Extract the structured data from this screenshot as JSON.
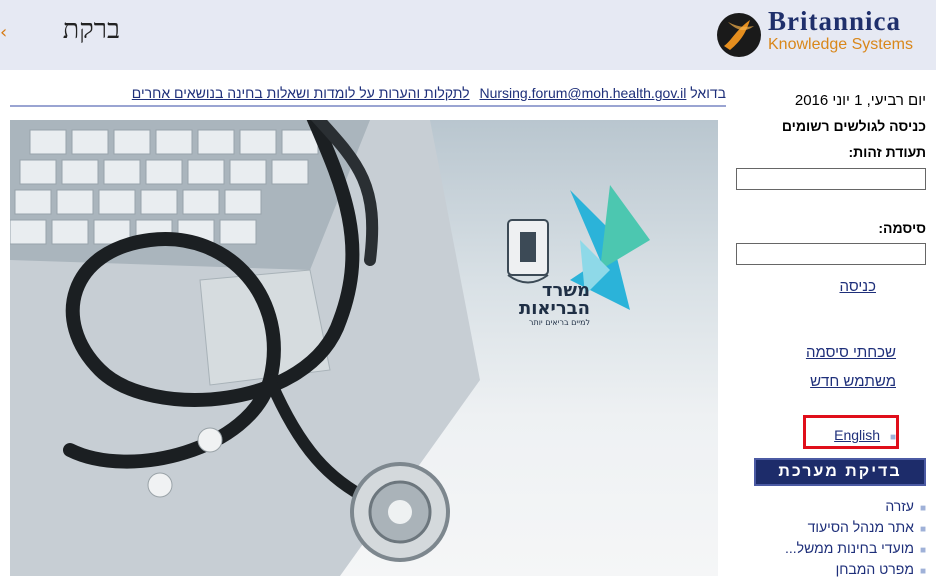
{
  "header": {
    "title": "ברקת",
    "logo": {
      "brand": "Britannica",
      "subtitle": "Knowledge Systems"
    }
  },
  "marquee": {
    "prefix": "בדואל",
    "email": "Nursing.forum@moh.health.gov.il",
    "text": "לתקלות והערות על לומדות ושאלות בחינה בנושאים אחרים"
  },
  "hero": {
    "ministry_name_line1": "משרד",
    "ministry_name_line2": "הבריאות",
    "ministry_tagline": "למיים בריאים יותר"
  },
  "sidebar": {
    "date": "יום רביעי, 1 יוני 2016",
    "registered_title": "כניסה לגולשים רשומים",
    "id_label": "תעודת זהות:",
    "password_label": "סיסמה:",
    "login_link": "כניסה",
    "forgot_password_link": "שכחתי סיסמה",
    "new_user_link": "משתמש חדש",
    "english_link": "English",
    "system_check_button": "בדיקת מערכת",
    "menu": [
      "עזרה",
      "אתר מנהל הסיעוד",
      "מועדי בחינות ממשל...",
      "מפרט המבחן"
    ]
  },
  "colors": {
    "header_bg": "#e6e9f3",
    "brand_blue": "#1f2f6b",
    "brand_orange": "#d9871a",
    "link_blue": "#1e2f7a",
    "highlight_red": "#e00e1a",
    "button_bg": "#1d2c6a"
  }
}
